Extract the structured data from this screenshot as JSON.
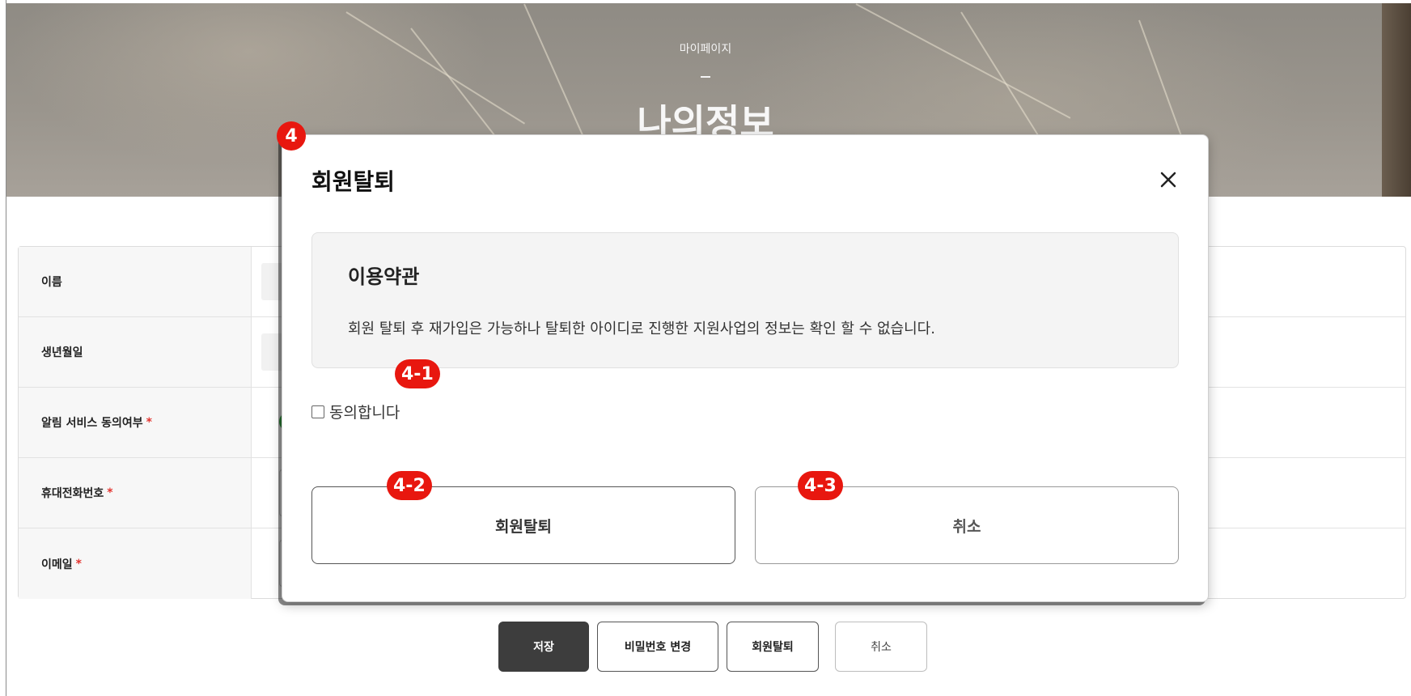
{
  "hero": {
    "subtitle": "마이페이지",
    "title": "나의정보"
  },
  "form": {
    "rows": [
      {
        "label": "이름",
        "required": ""
      },
      {
        "label": "생년월일",
        "required": ""
      },
      {
        "label": "알림 서비스 동의여부",
        "required": "*"
      },
      {
        "label": "휴대전화번호",
        "required": "*"
      },
      {
        "label": "이메일",
        "required": "*"
      }
    ]
  },
  "actions": {
    "save": "저장",
    "change_password": "비밀번호 변경",
    "withdraw": "회원탈퇴",
    "cancel": "취소"
  },
  "modal": {
    "title": "회원탈퇴",
    "terms_title": "이용약관",
    "terms_text": "회원 탈퇴 후 재가입은 가능하나 탈퇴한 아이디로 진행한 지원사업의 정보는 확인 할 수 없습니다.",
    "agree_label": "동의합니다",
    "agree_checked": false,
    "withdraw_button": "회원탈퇴",
    "cancel_button": "취소"
  },
  "annotations": [
    "4",
    "4-1",
    "4-2",
    "4-3"
  ],
  "colors": {
    "badge": "#e8170f",
    "primary_button": "#3d3d3d",
    "radio_on": "#3cb44b",
    "required_star": "#e3342f"
  }
}
